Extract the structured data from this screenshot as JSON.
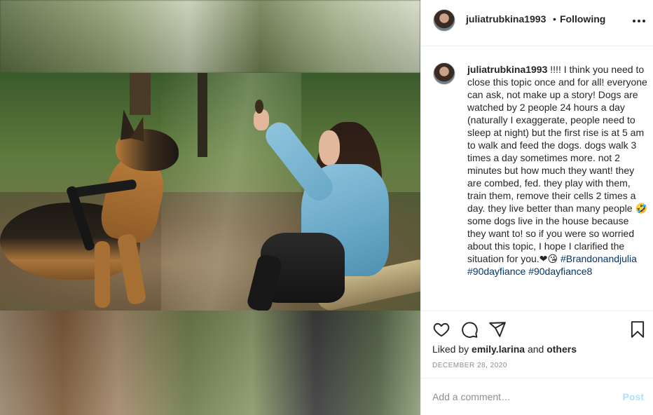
{
  "post": {
    "username": "juliatrubkina1993",
    "follow_separator": "•",
    "follow_status": "Following",
    "more_options": "more-icon"
  },
  "caption": {
    "username": "juliatrubkina1993",
    "text_line1": " !!!! I think you need to close this topic once and for all! everyone can ask, not make up a story! Dogs are watched by 2 people 24 hours a day (naturally I exaggerate, people need to sleep at night) but the first rise is at 5 am to walk and feed the dogs. dogs walk 3 times a day sometimes more. not 2 minutes but how much they want! they are combed, fed. they play with them, train them, remove their cells 2 times a day. they live better than many people ",
    "emoji_1": "🤣",
    "text_line2": " some dogs live in the house because they want to! so if you were so worried about this topic, I hope I clarified the situation for you.",
    "emoji_2": "❤😘",
    "hashtags": [
      "#Brandonandjulia",
      "#90dayfiance",
      "#90dayfiance8"
    ]
  },
  "actions": {
    "like_icon": "heart-icon",
    "comment_icon": "comment-icon",
    "share_icon": "share-icon",
    "save_icon": "bookmark-icon"
  },
  "likes": {
    "prefix": "Liked by ",
    "user": "emily.larina",
    "middle": " and ",
    "others": "others"
  },
  "date": "DECEMBER 28, 2020",
  "add_comment": {
    "placeholder": "Add a comment…",
    "post_label": "Post",
    "post_color": "#b2dffc"
  },
  "colors": {
    "text": "#262626",
    "secondary": "#8e8e8e",
    "hashtag": "#00376b",
    "border": "#efefef"
  }
}
